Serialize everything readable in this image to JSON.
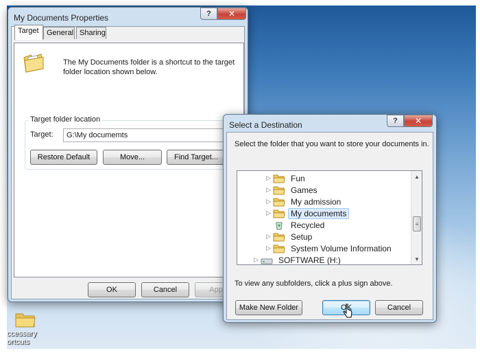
{
  "desktop": {
    "folder_label": "ccessary",
    "folder_label2": "ortcuts"
  },
  "properties_window": {
    "title": "My Documents Properties",
    "help_label": "?",
    "close_label": "✕",
    "tabs": [
      {
        "label": "Target"
      },
      {
        "label": "General"
      },
      {
        "label": "Sharing"
      }
    ],
    "description_line1": "The My Documents folder is a shortcut to the target",
    "description_line2": "folder location shown below.",
    "group_label": "Target folder location",
    "target_label": "Target:",
    "target_value": "G:\\My documemts",
    "restore_default_label": "Restore Default",
    "move_label": "Move...",
    "find_target_label": "Find Target...",
    "ok_label": "OK",
    "cancel_label": "Cancel",
    "apply_label": "Apply"
  },
  "destination_dialog": {
    "title": "Select a Destination",
    "help_label": "?",
    "close_label": "✕",
    "instruction": "Select the folder that you want to store your documents in.",
    "tree_items": [
      {
        "label": "Fun",
        "icon": "folder-icon"
      },
      {
        "label": "Games",
        "icon": "folder-icon"
      },
      {
        "label": "My admission",
        "icon": "folder-icon"
      },
      {
        "label": "My documemts",
        "icon": "folder-icon",
        "selected": true
      },
      {
        "label": "Recycled",
        "icon": "recycle-bin-icon"
      },
      {
        "label": "Setup",
        "icon": "folder-icon"
      },
      {
        "label": "System Volume Information",
        "icon": "folder-icon"
      },
      {
        "label": "SOFTWARE (H:)",
        "icon": "drive-icon"
      }
    ],
    "hint": "To view any subfolders, click a plus sign above.",
    "make_new_folder_label": "Make New Folder",
    "ok_label": "OK",
    "cancel_label": "Cancel"
  },
  "colors": {
    "desktop_top": "#20599a",
    "desktop_bottom": "#dde9f5",
    "selection": "#dcebfc",
    "close_button": "#c7433a"
  }
}
